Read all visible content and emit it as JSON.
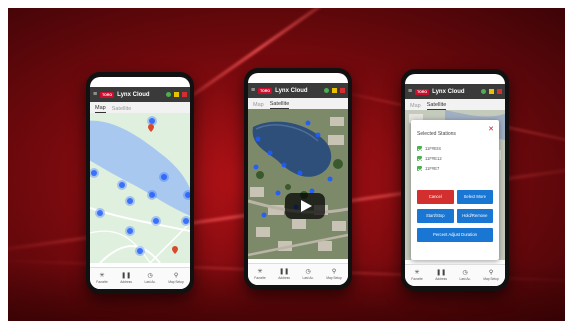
{
  "colors": {
    "brand_red": "#c8102e",
    "status_green": "#4caf50",
    "status_yellow": "#e6c200",
    "status_red": "#d32f2f",
    "sprinkler_blue": "#1e5bff"
  },
  "app": {
    "logo_text": "TORO",
    "title": "Lynx Cloud"
  },
  "tabs": {
    "map": "Map",
    "satellite": "Satellite"
  },
  "bottom_nav": [
    {
      "label": "Favorite",
      "icon": "star-icon"
    },
    {
      "label": "Address",
      "icon": "pause-icon"
    },
    {
      "label": "Last Ac.",
      "icon": "clock-icon"
    },
    {
      "label": "Map Setup",
      "icon": "pin-icon"
    }
  ],
  "dialog": {
    "title": "Selected Stations",
    "close": "✕",
    "stations": [
      "11F#EIS",
      "11F#E12",
      "11F#E7"
    ],
    "buttons": {
      "cancel": "Cancel",
      "select_more": "Select More",
      "start_stop": "Start/Stop",
      "hold_remove": "Hold/Remove",
      "percent_adjust": "Percent Adjust Duration"
    }
  },
  "video": {
    "play_icon": "play-icon"
  }
}
